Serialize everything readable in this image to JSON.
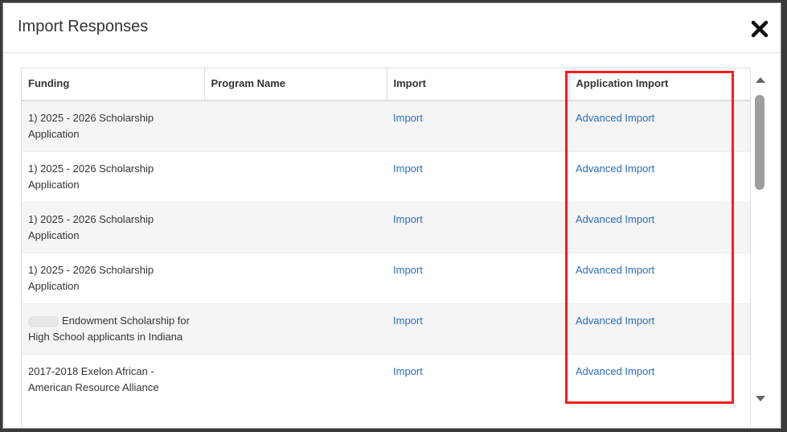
{
  "modal": {
    "title": "Import Responses",
    "close_icon": "close-x-icon"
  },
  "table": {
    "headers": [
      "Funding",
      "Program Name",
      "Import",
      "Application Import"
    ],
    "rows": [
      {
        "funding": "1) 2025 - 2026 Scholarship Application",
        "program": "",
        "import": "Import",
        "app_import": "Advanced Import"
      },
      {
        "funding": "1) 2025 - 2026 Scholarship Application",
        "program": "",
        "import": "Import",
        "app_import": "Advanced Import"
      },
      {
        "funding": "1) 2025 - 2026 Scholarship Application",
        "program": "",
        "import": "Import",
        "app_import": "Advanced Import"
      },
      {
        "funding": "1) 2025 - 2026 Scholarship Application",
        "program": "",
        "import": "Import",
        "app_import": "Advanced Import"
      },
      {
        "funding": "Endowment Scholarship for High School applicants in Indiana",
        "program": "",
        "import": "Import",
        "app_import": "Advanced Import"
      },
      {
        "funding": "2017-2018 Exelon African - American Resource Alliance",
        "program": "",
        "import": "Import",
        "app_import": "Advanced Import"
      }
    ]
  },
  "colors": {
    "link": "#2a6ebb",
    "highlight": "#ff1a1a",
    "row_alt": "#f5f5f5"
  }
}
